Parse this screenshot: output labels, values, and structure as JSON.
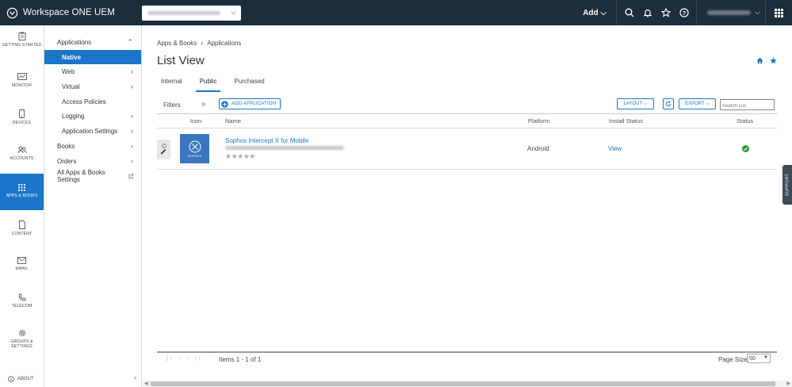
{
  "header": {
    "brand": "Workspace ONE UEM",
    "add_label": "Add",
    "icons": [
      "search-icon",
      "bell-icon",
      "star-icon",
      "help-icon",
      "apps-grid-icon"
    ]
  },
  "rail": {
    "items": [
      {
        "label": "GETTING STARTED",
        "icon": "clipboard-icon"
      },
      {
        "label": "MONITOR",
        "icon": "monitor-icon"
      },
      {
        "label": "DEVICES",
        "icon": "phone-icon"
      },
      {
        "label": "ACCOUNTS",
        "icon": "users-icon"
      },
      {
        "label": "APPS & BOOKS",
        "icon": "grid-icon",
        "active": true
      },
      {
        "label": "CONTENT",
        "icon": "file-icon"
      },
      {
        "label": "EMAIL",
        "icon": "mail-icon"
      },
      {
        "label": "TELECOM",
        "icon": "telephone-icon"
      },
      {
        "label": "GROUPS & SETTINGS",
        "icon": "gear-icon"
      }
    ],
    "about": "ABOUT"
  },
  "subnav": {
    "applications": "Applications",
    "native": "Native",
    "web": "Web",
    "virtual": "Virtual",
    "access_policies": "Access Policies",
    "logging": "Logging",
    "application_settings": "Application Settings",
    "books": "Books",
    "orders": "Orders",
    "all_settings": "All Apps & Books Settings"
  },
  "breadcrumb": {
    "root": "Apps & Books",
    "current": "Applications"
  },
  "page_title": "List View",
  "tabs": [
    "Internal",
    "Public",
    "Purchased"
  ],
  "active_tab": "Public",
  "toolbar": {
    "filters": "Filters",
    "add_application": "ADD APPLICATION",
    "layout": "LAYOUT",
    "export": "EXPORT",
    "search_placeholder": "Search List"
  },
  "table": {
    "columns": [
      "Icon",
      "Name",
      "Platform",
      "Install Status",
      "Status"
    ],
    "rows": [
      {
        "icon_label": "SOPHOS",
        "name": "Sophos Intercept X for Mobile",
        "platform": "Android",
        "install_status": "View",
        "status": "ok"
      }
    ]
  },
  "footer": {
    "items": "Items 1 - 1 of 1",
    "page_size_label": "Page Size:",
    "page_size": "50"
  },
  "support": "SUPPORT",
  "colors": {
    "header": "#1d2d3b",
    "accent": "#1b75c9",
    "success": "#1f9d3a"
  }
}
